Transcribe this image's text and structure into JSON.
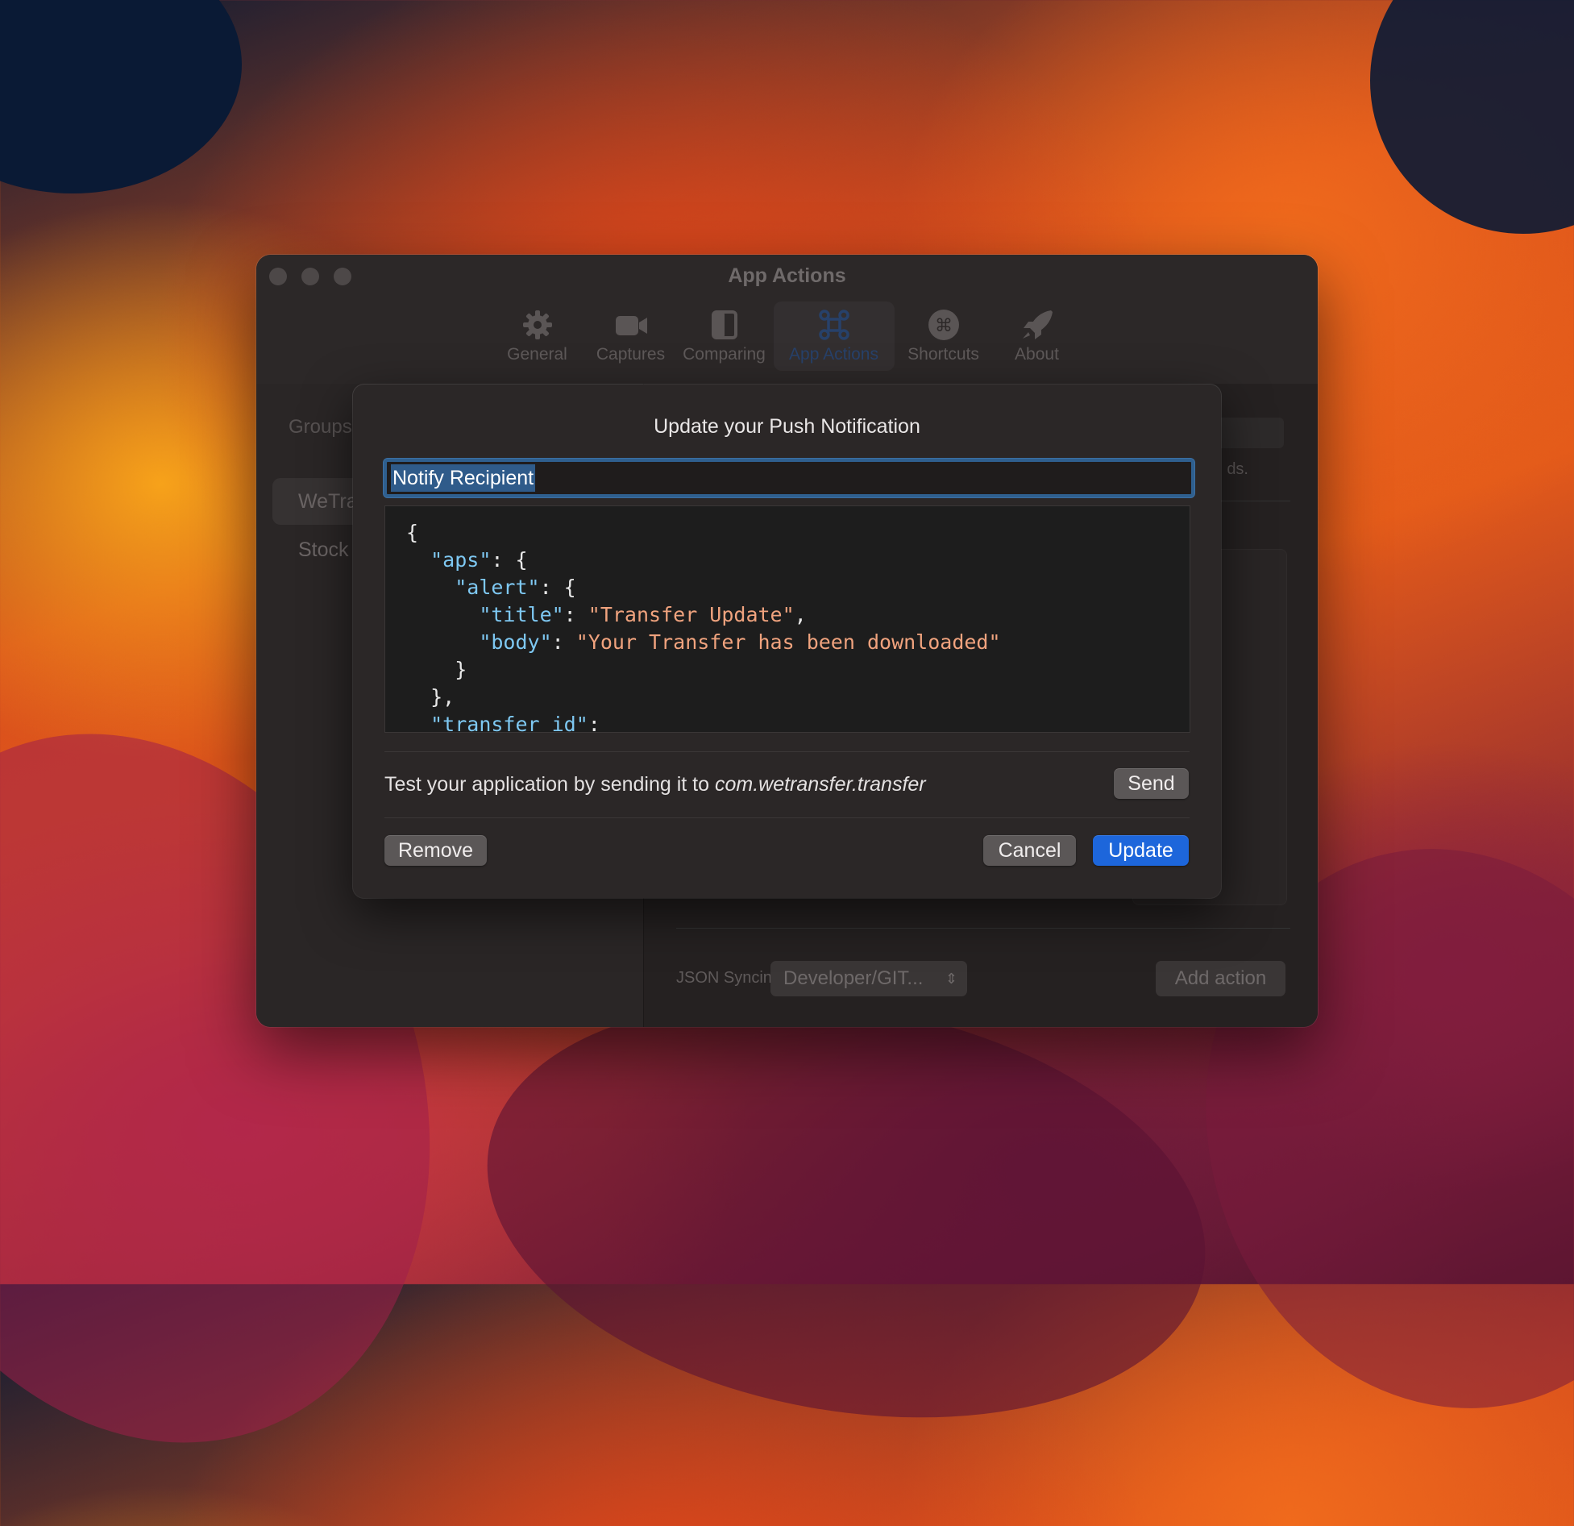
{
  "window": {
    "title": "App Actions",
    "toolbar": [
      {
        "label": "General",
        "icon": "gear-icon"
      },
      {
        "label": "Captures",
        "icon": "video-camera-icon"
      },
      {
        "label": "Comparing",
        "icon": "split-view-icon"
      },
      {
        "label": "App Actions",
        "icon": "command-icon",
        "active": true
      },
      {
        "label": "Shortcuts",
        "icon": "command-circle-icon"
      },
      {
        "label": "About",
        "icon": "rocket-icon"
      }
    ]
  },
  "sidebar": {
    "heading": "Groups",
    "items": [
      {
        "label": "WeTra",
        "selected": true
      },
      {
        "label": "Stock",
        "selected": false
      }
    ]
  },
  "content": {
    "partial_text": "ds.",
    "json_syncing_label": "JSON Syncing",
    "json_syncing_value": "Developer/GIT...",
    "add_action_label": "Add action"
  },
  "sheet": {
    "title": "Update your Push Notification",
    "name_value": "Notify Recipient",
    "code_lines": [
      [
        {
          "t": "p",
          "v": "{"
        }
      ],
      [
        {
          "t": "p",
          "v": "  "
        },
        {
          "t": "k",
          "v": "\"aps\""
        },
        {
          "t": "p",
          "v": ": {"
        }
      ],
      [
        {
          "t": "p",
          "v": "    "
        },
        {
          "t": "k",
          "v": "\"alert\""
        },
        {
          "t": "p",
          "v": ": {"
        }
      ],
      [
        {
          "t": "p",
          "v": "      "
        },
        {
          "t": "k",
          "v": "\"title\""
        },
        {
          "t": "p",
          "v": ": "
        },
        {
          "t": "s",
          "v": "\"Transfer Update\""
        },
        {
          "t": "p",
          "v": ","
        }
      ],
      [
        {
          "t": "p",
          "v": "      "
        },
        {
          "t": "k",
          "v": "\"body\""
        },
        {
          "t": "p",
          "v": ": "
        },
        {
          "t": "s",
          "v": "\"Your Transfer has been downloaded\""
        }
      ],
      [
        {
          "t": "p",
          "v": "    }"
        }
      ],
      [
        {
          "t": "p",
          "v": "  },"
        }
      ],
      [
        {
          "t": "p",
          "v": "  "
        },
        {
          "t": "k",
          "v": "\"transfer_id\""
        },
        {
          "t": "p",
          "v": ":"
        }
      ]
    ],
    "test_prefix": "Test your application by sending it to ",
    "bundle_id": "com.wetransfer.transfer",
    "send_label": "Send",
    "remove_label": "Remove",
    "cancel_label": "Cancel",
    "update_label": "Update"
  },
  "colors": {
    "accent": "#1d66db",
    "json_key": "#7ec8f2",
    "json_string": "#f0a37e"
  }
}
